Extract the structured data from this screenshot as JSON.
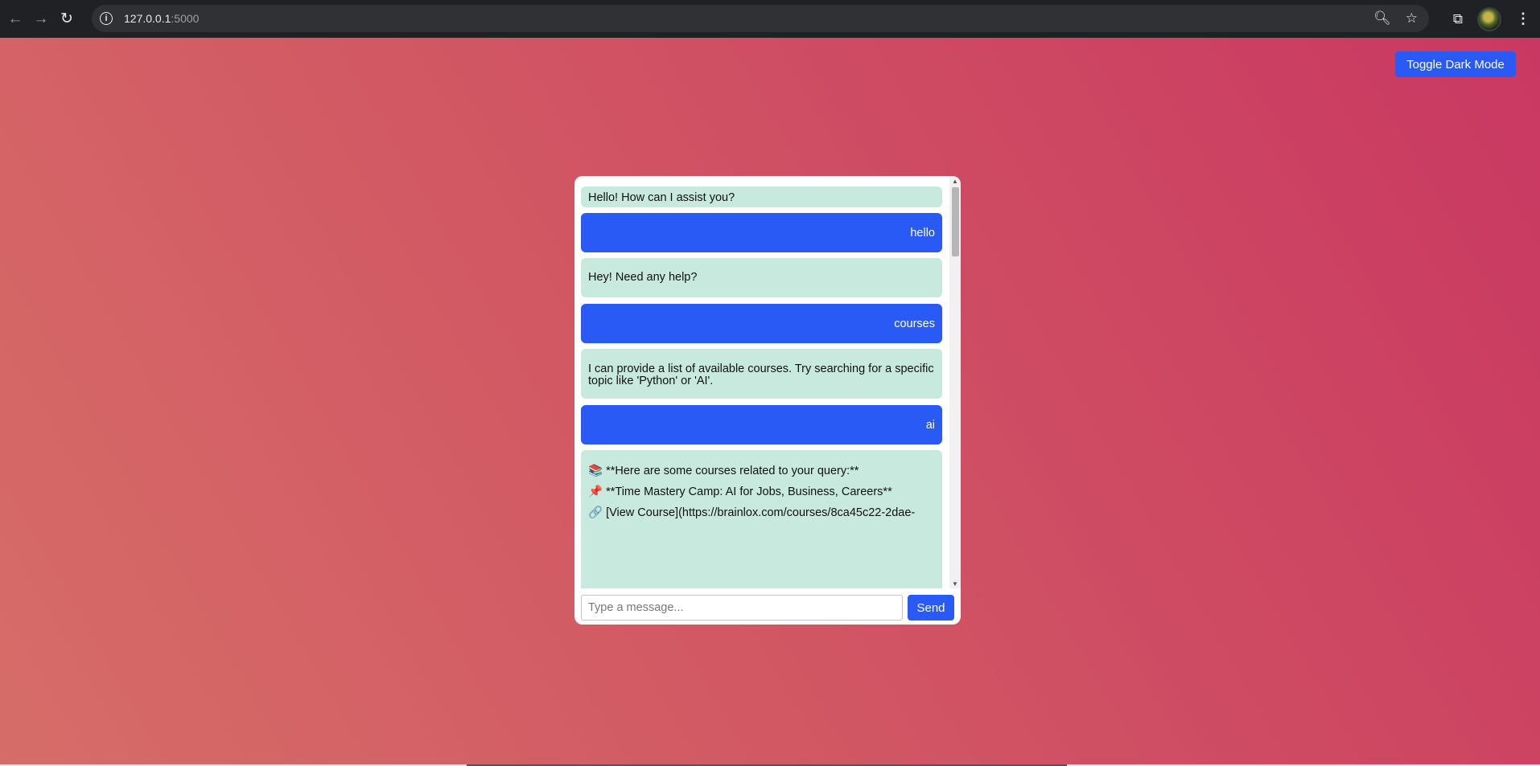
{
  "browser": {
    "url_host": "127.0.0.1",
    "url_port": ":5000",
    "back_icon": "arrow-left-icon",
    "forward_icon": "arrow-right-icon",
    "reload_icon": "reload-icon"
  },
  "page": {
    "toggle_label": "Toggle Dark Mode",
    "gradient_colors": [
      "#d66d68",
      "#d15663",
      "#c93862"
    ]
  },
  "chat": {
    "messages": [
      {
        "role": "bot",
        "text": "Hello! How can I assist you?"
      },
      {
        "role": "user",
        "text": "hello"
      },
      {
        "role": "bot",
        "text": "Hey! Need any help?"
      },
      {
        "role": "user",
        "text": "courses"
      },
      {
        "role": "bot",
        "text": "I can provide a list of available courses. Try searching for a specific topic like 'Python' or 'AI'."
      },
      {
        "role": "user",
        "text": "ai"
      },
      {
        "role": "bot",
        "lines": [
          "📚 **Here are some courses related to your query:**",
          "📌 **Time Mastery Camp: AI for Jobs, Business, Careers**",
          "🔗 [View Course](https://brainlox.com/courses/8ca45c22-2dae-"
        ]
      }
    ],
    "input_placeholder": "Type a message...",
    "send_label": "Send"
  },
  "colors": {
    "bot_bubble": "#c8e9dd",
    "user_bubble": "#2a5af6",
    "button": "#2a5af6"
  }
}
